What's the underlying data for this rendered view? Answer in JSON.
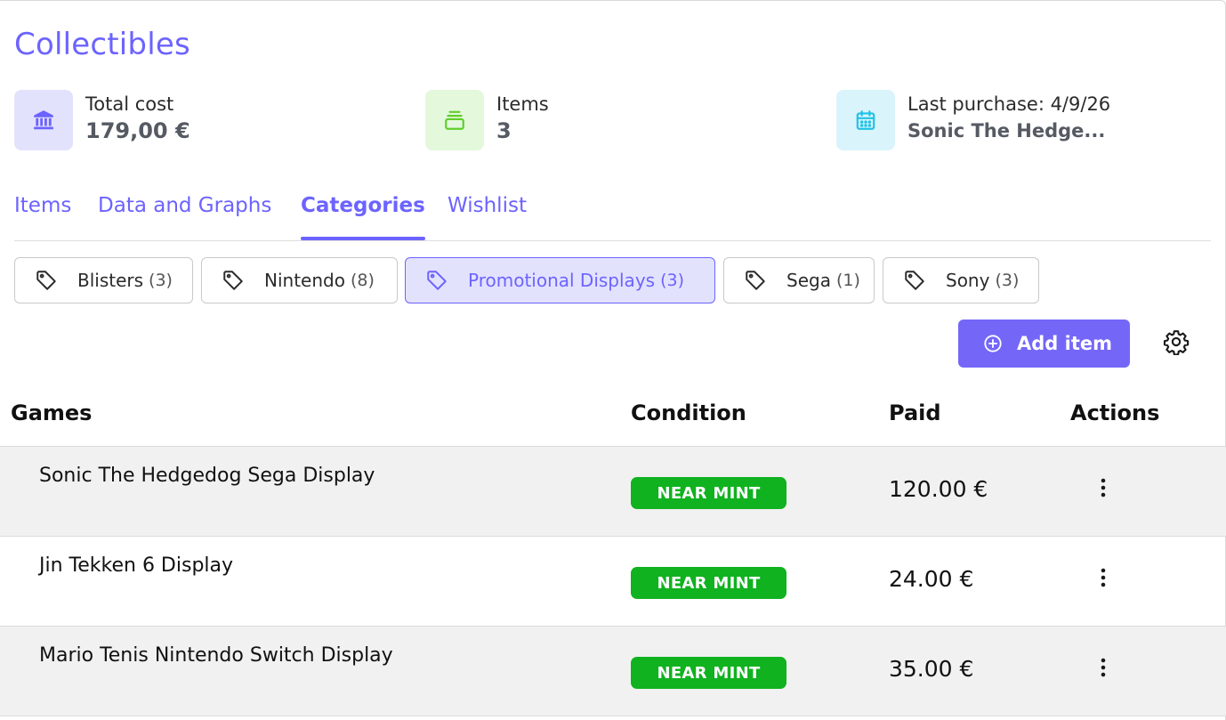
{
  "app": {
    "title": "Collectibles"
  },
  "stats": [
    {
      "label": "Total cost",
      "value": "179,00 €",
      "icon": "bank-icon",
      "bg": "#e3e2fd",
      "fg": "#6c63ff"
    },
    {
      "label": "Items",
      "value": "3",
      "icon": "stack-icon",
      "bg": "#e4f8dc",
      "fg": "#5fce2b"
    },
    {
      "label": "Last purchase: 4/9/26",
      "value": "Sonic The Hedge...",
      "icon": "calendar-icon",
      "bg": "#d9f4fb",
      "fg": "#1fc2e6"
    }
  ],
  "tabs": [
    {
      "label": "Items",
      "active": false
    },
    {
      "label": "Data and Graphs",
      "active": false
    },
    {
      "label": "Categories",
      "active": true
    },
    {
      "label": "Wishlist",
      "active": false
    }
  ],
  "categories": [
    {
      "name": "Blisters",
      "count": "(3)",
      "active": false
    },
    {
      "name": "Nintendo",
      "count": "(8)",
      "active": false
    },
    {
      "name": "Promotional Displays",
      "count": "(3)",
      "active": true
    },
    {
      "name": "Sega",
      "count": "(1)",
      "active": false
    },
    {
      "name": "Sony",
      "count": "(3)",
      "active": false
    }
  ],
  "toolbar": {
    "add_label": "Add item",
    "add_icon": "plus-circle-icon",
    "settings_icon": "gear-icon"
  },
  "table": {
    "headers": {
      "games": "Games",
      "condition": "Condition",
      "paid": "Paid",
      "actions": "Actions"
    },
    "rows": [
      {
        "name": "Sonic The Hedgedog Sega Display",
        "condition": "NEAR MINT",
        "paid": "120.00 €"
      },
      {
        "name": "Jin Tekken 6 Display",
        "condition": "NEAR MINT",
        "paid": "24.00 €"
      },
      {
        "name": "Mario Tenis Nintendo Switch Display",
        "condition": "NEAR MINT",
        "paid": "35.00 €"
      }
    ]
  },
  "colors": {
    "accent": "#6c63ff",
    "button": "#7467f8",
    "badge": "#10b21f",
    "row_alt": "#f1f1f1"
  }
}
